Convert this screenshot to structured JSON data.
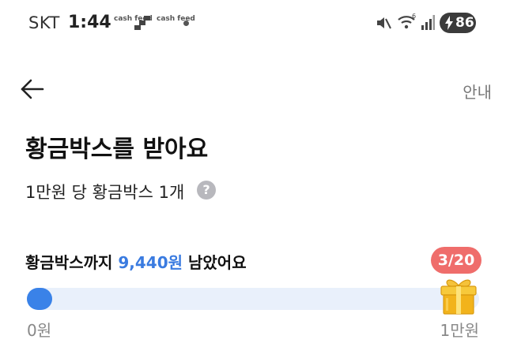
{
  "status_bar": {
    "carrier": "SKT",
    "time": "1:44",
    "app_badge_1": "cash feed",
    "app_badge_2": "cash feed",
    "battery": "86"
  },
  "header": {
    "back_icon": "arrow-left-icon",
    "help_label": "안내"
  },
  "main": {
    "title": "황금박스를 받아요",
    "subtitle": "1만원 당 황금박스 1개",
    "info_icon": "?",
    "remaining_prefix": "황금박스까지 ",
    "remaining_amount": "9,440원",
    "remaining_suffix": " 남았어요",
    "count_badge": "3/20",
    "progress_fraction": 0.056,
    "min_label": "0원",
    "max_label": "1만원"
  },
  "colors": {
    "accent_blue": "#3a82e8",
    "track": "#e9f0fb",
    "badge_red": "#ef6d6b",
    "gift_gold": "#f2b31b"
  }
}
